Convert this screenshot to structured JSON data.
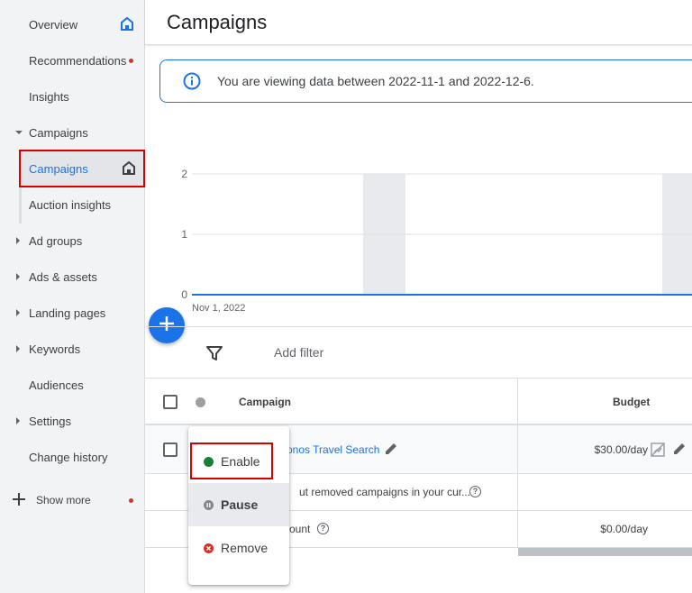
{
  "sidebar": {
    "items": [
      {
        "label": "Overview"
      },
      {
        "label": "Recommendations"
      },
      {
        "label": "Insights"
      },
      {
        "label": "Campaigns"
      },
      {
        "label": "Campaigns"
      },
      {
        "label": "Auction insights"
      },
      {
        "label": "Ad groups"
      },
      {
        "label": "Ads & assets"
      },
      {
        "label": "Landing pages"
      },
      {
        "label": "Keywords"
      },
      {
        "label": "Audiences"
      },
      {
        "label": "Settings"
      },
      {
        "label": "Change history"
      }
    ],
    "show_more": "Show more"
  },
  "header": {
    "title": "Campaigns"
  },
  "banner": {
    "text": "You are viewing data between 2022-11-1 and 2022-12-6."
  },
  "chart_data": {
    "type": "line",
    "x_start_label": "Nov 1, 2022",
    "yticks": [
      "2",
      "1",
      "0"
    ],
    "ylim": [
      0,
      2
    ],
    "series": [
      {
        "values": [
          0,
          0
        ]
      }
    ],
    "grid": true
  },
  "filter": {
    "add_filter": "Add filter"
  },
  "table": {
    "headers": {
      "campaign": "Campaign",
      "budget": "Budget"
    },
    "rows": [
      {
        "campaign": "onos Travel Search",
        "budget": "$30.00/day"
      },
      {
        "text": "ut removed campaigns in your cur..."
      },
      {
        "text": "ount",
        "budget": "$0.00/day"
      }
    ]
  },
  "status_menu": {
    "items": [
      {
        "label": "Enable",
        "color": "#188038"
      },
      {
        "label": "Pause",
        "color": "#80868b"
      },
      {
        "label": "Remove",
        "color": "#d93025"
      }
    ]
  },
  "colors": {
    "accent": "#1a73e8",
    "highlight": "#d50000"
  }
}
